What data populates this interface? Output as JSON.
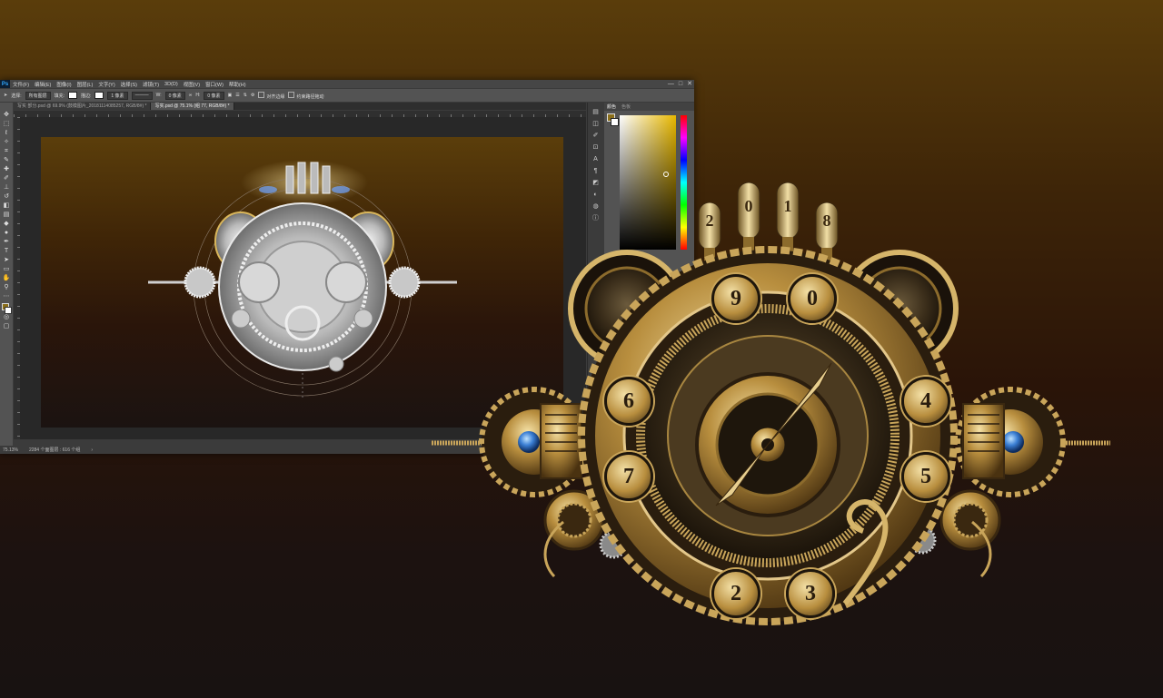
{
  "app": {
    "logo": "Ps",
    "menu": [
      "文件(F)",
      "编辑(E)",
      "图像(I)",
      "图层(L)",
      "文字(Y)",
      "选择(S)",
      "滤镜(T)",
      "3D(D)",
      "视图(V)",
      "窗口(W)",
      "帮助(H)"
    ],
    "window_controls": [
      "—",
      "□",
      "✕"
    ]
  },
  "options_bar": {
    "tool_label": "选择:",
    "mode_value": "所有图层",
    "fill_label": "填充:",
    "stroke_label": "描边:",
    "stroke_width": "1 像素",
    "w_label": "W:",
    "w_value": "0 像素",
    "h_label": "H:",
    "h_value": "0 像素",
    "align_edges": "对齐边缘",
    "constrain_path": "约束路径拖动"
  },
  "tabs": [
    {
      "label": "写实 部分.psd @ 69.9% (鼓模图片_20181114085257, RGB/8#) *"
    },
    {
      "label": "写实.psd @ 75.1% (组 77, RGB/8#) *"
    }
  ],
  "status": {
    "zoom": "75.13%",
    "doc_info": "2284 个面图层 : 616 个组"
  },
  "color_panel": {
    "tabs": [
      "颜色",
      "色板"
    ],
    "foreground": "#8a6e1a",
    "background": "#ffffff"
  },
  "artwork": {
    "digits_top": [
      "2",
      "0",
      "1",
      "8"
    ],
    "dial_digits": [
      "9",
      "0",
      "6",
      "4",
      "7",
      "5",
      "2",
      "3"
    ]
  },
  "colors": {
    "bg_top": "#5a3d0b",
    "bg_bottom": "#181211",
    "brass": "#c9a55a",
    "gem_blue": "#3b7fd4"
  }
}
